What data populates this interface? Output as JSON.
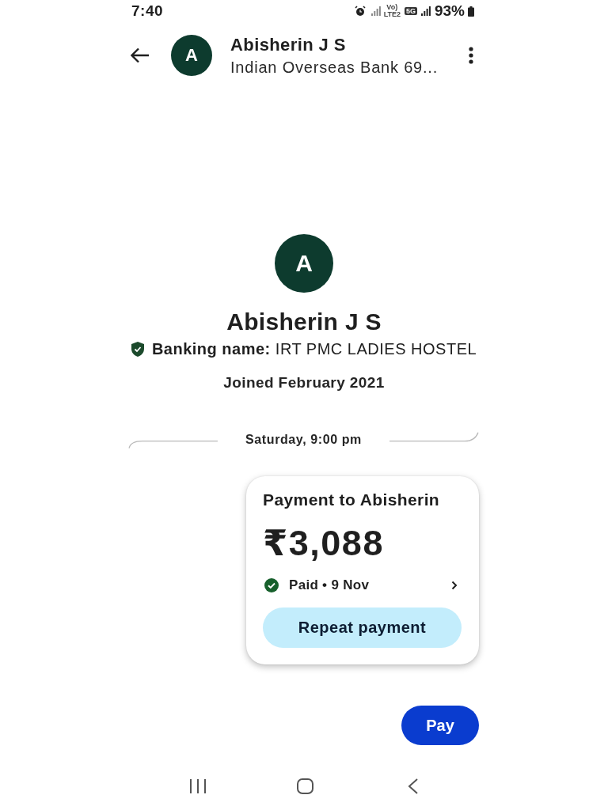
{
  "status_bar": {
    "time": "7:40",
    "volte": "Vo) LTE2",
    "network": "5G",
    "battery": "93%"
  },
  "header": {
    "avatar_letter": "A",
    "title": "Abisherin J S",
    "subtitle": "Indian Overseas Bank 69..."
  },
  "profile": {
    "avatar_letter": "A",
    "name": "Abisherin J S",
    "verified": true,
    "banking_name": "**Banking name:** IRT PMC LADIES HOSTEL",
    "joined": "Joined February 2021"
  },
  "timeline": [
    {
      "kind": "date_divider",
      "label": "Saturday, 9:00 pm"
    },
    {
      "kind": "payment_card",
      "title": "Payment to Abisherin",
      "amount": "₹3,088",
      "paid": true,
      "status": "Paid • 9 Nov",
      "action": "Repeat payment"
    }
  ],
  "pay_button": "Pay"
}
